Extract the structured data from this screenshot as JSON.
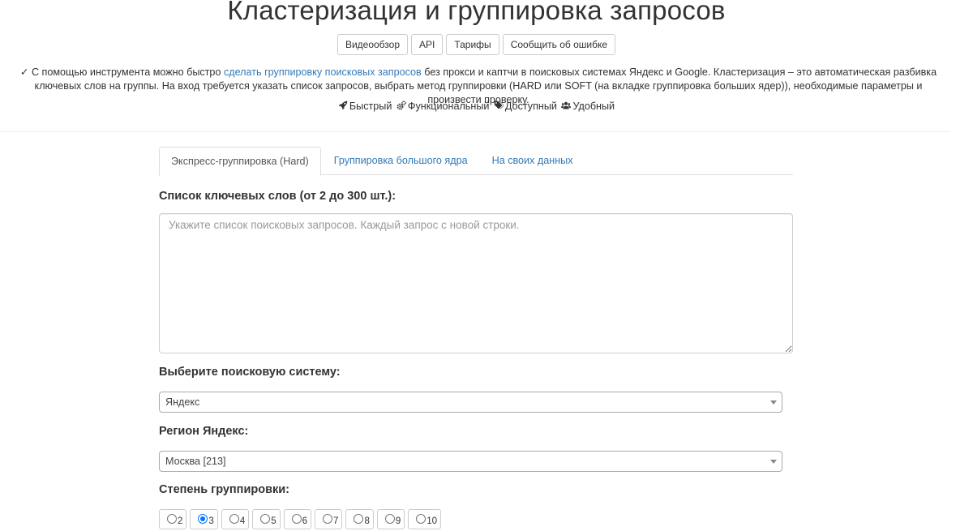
{
  "header": {
    "title": "Кластеризация и группировка запросов",
    "buttons": [
      "Видеообзор",
      "API",
      "Тарифы",
      "Сообщить об ошибке"
    ]
  },
  "intro": {
    "checkmark": "✓",
    "before_link": "С помощью инструмента можно быстро ",
    "link_text": "сделать группировку поисковых запросов",
    "after_link": " без прокси и каптчи в поисковых системах Яндекс и Google. Кластеризация – это автоматическая разбивка ключевых слов на группы. На вход требуется указать список запросов, выбрать метод группировки (HARD или SOFT (на вкладке группировка больших ядер)), необходимые параметры и произвести проверку."
  },
  "features": [
    {
      "icon": "rocket-icon",
      "label": "Быстрый"
    },
    {
      "icon": "gears-icon",
      "label": "Функциональный"
    },
    {
      "icon": "tags-icon",
      "label": "Доступный"
    },
    {
      "icon": "users-icon",
      "label": "Удобный"
    }
  ],
  "tabs": [
    {
      "label": "Экспресс-группировка (Hard)",
      "active": true
    },
    {
      "label": "Группировка большого ядра",
      "active": false
    },
    {
      "label": "На своих данных",
      "active": false
    }
  ],
  "keywords": {
    "label": "Список ключевых слов (от 2 до 300 шт.):",
    "placeholder": "Укажите список поисковых запросов. Каждый запрос с новой строки.",
    "value": ""
  },
  "search_engine": {
    "label": "Выберите поисковую систему:",
    "selected": "Яндекс"
  },
  "region": {
    "label": "Регион Яндекс:",
    "selected": "Москва [213]"
  },
  "grouping": {
    "label": "Степень группировки:",
    "options": [
      "2",
      "3",
      "4",
      "5",
      "6",
      "7",
      "8",
      "9",
      "10"
    ],
    "selected": "3"
  },
  "colors": {
    "link": "#337ab7",
    "radio_checked": "#0075ff"
  }
}
